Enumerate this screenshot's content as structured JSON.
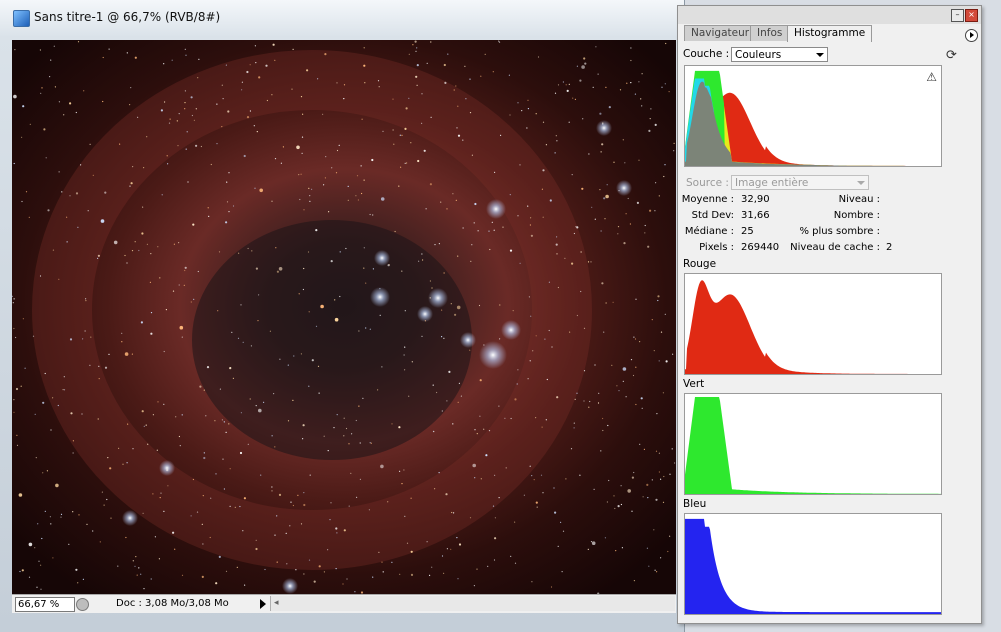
{
  "document": {
    "title": "Sans titre-1 @ 66,7% (RVB/8#)",
    "zoom": "66,67 %",
    "doc_info": "Doc : 3,08 Mo/3,08 Mo"
  },
  "panel": {
    "tabs": [
      {
        "label": "Navigateur",
        "active": false
      },
      {
        "label": "Infos",
        "active": false
      },
      {
        "label": "Histogramme",
        "active": true
      }
    ],
    "channel_label": "Couche :",
    "channel_value": "Couleurs",
    "source_label": "Source :",
    "source_value": "Image entière",
    "stats_left": [
      {
        "label": "Moyenne :",
        "value": "32,90"
      },
      {
        "label": "Std Dev:",
        "value": "31,66"
      },
      {
        "label": "Médiane :",
        "value": "25"
      },
      {
        "label": "Pixels :",
        "value": "269440"
      }
    ],
    "stats_right": [
      {
        "label": "Niveau :",
        "value": ""
      },
      {
        "label": "Nombre :",
        "value": ""
      },
      {
        "label": "% plus sombre :",
        "value": ""
      },
      {
        "label": "Niveau de cache :",
        "value": "2"
      }
    ],
    "red_label": "Rouge",
    "green_label": "Vert",
    "blue_label": "Bleu"
  },
  "colors": {
    "red": "#e02a14",
    "green": "#2ee82e",
    "blue": "#2424f0",
    "yellow": "#e8e81c",
    "cyan": "#22d8e8",
    "gray": "#7c8478",
    "magenta": "#e020e0"
  }
}
